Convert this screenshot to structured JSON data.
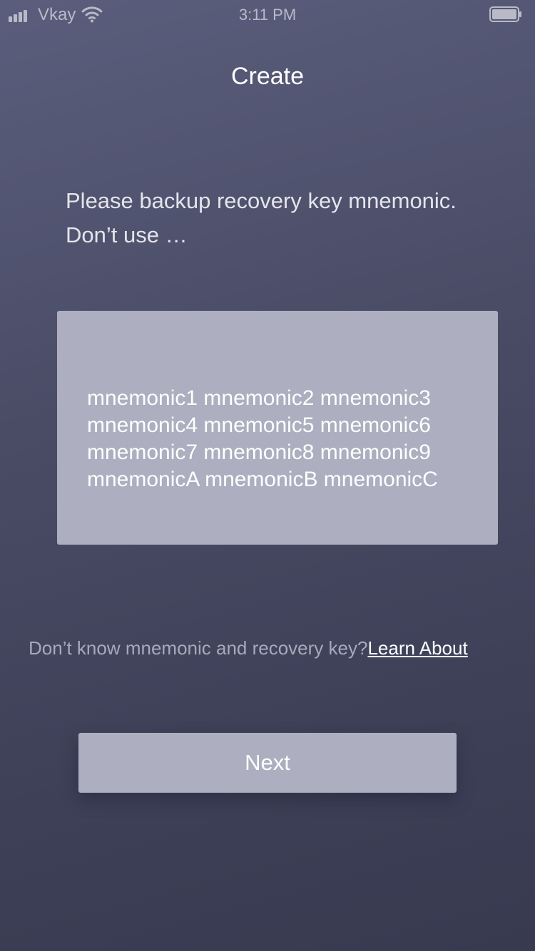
{
  "status_bar": {
    "carrier": "Vkay",
    "time": "3:11 PM",
    "icons": [
      "signal-icon",
      "wifi-icon",
      "battery-icon"
    ]
  },
  "header": {
    "title": "Create"
  },
  "instructions": {
    "line1": "Please backup recovery key mnemonic.",
    "line2": "Don’t use …"
  },
  "mnemonic": {
    "lines": [
      "mnemonic1 mnemonic2 mnemonic3",
      "mnemonic4 mnemonic5 mnemonic6",
      "mnemonic7 mnemonic8 mnemonic9",
      "mnemonicA mnemonicB mnemonicC"
    ]
  },
  "help": {
    "text": "Don’t know mnemonic and recovery key?",
    "link_label": "Learn About"
  },
  "actions": {
    "next_label": "Next"
  },
  "colors": {
    "background_top": "#5a5e7c",
    "background_bottom": "#383a50",
    "panel": "#adaebf",
    "link": "#ffffff",
    "muted_text": "#a7a9bb"
  }
}
